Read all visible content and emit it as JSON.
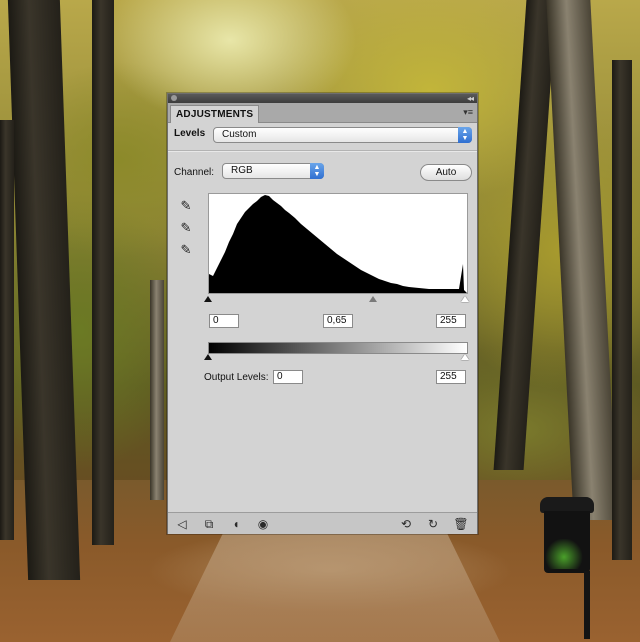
{
  "panel": {
    "tab_title": "ADJUSTMENTS",
    "panel_menu_icon": "panel-menu-icon",
    "levels_label": "Levels",
    "preset_value": "Custom",
    "channel_label": "Channel:",
    "channel_value": "RGB",
    "auto_label": "Auto",
    "input_levels": {
      "black": "0",
      "gamma": "0,65",
      "white": "255"
    },
    "output_label": "Output Levels:",
    "output_levels": {
      "black": "0",
      "white": "255"
    },
    "eyedroppers": [
      "eyedropper-black-icon",
      "eyedropper-gray-icon",
      "eyedropper-white-icon"
    ],
    "footer_icons_left": [
      "return-arrow-icon",
      "clip-to-layer-icon",
      "layer-visibility-toggle-icon",
      "eye-icon"
    ],
    "footer_icons_right": [
      "view-previous-state-icon",
      "reset-icon",
      "trash-icon"
    ]
  }
}
